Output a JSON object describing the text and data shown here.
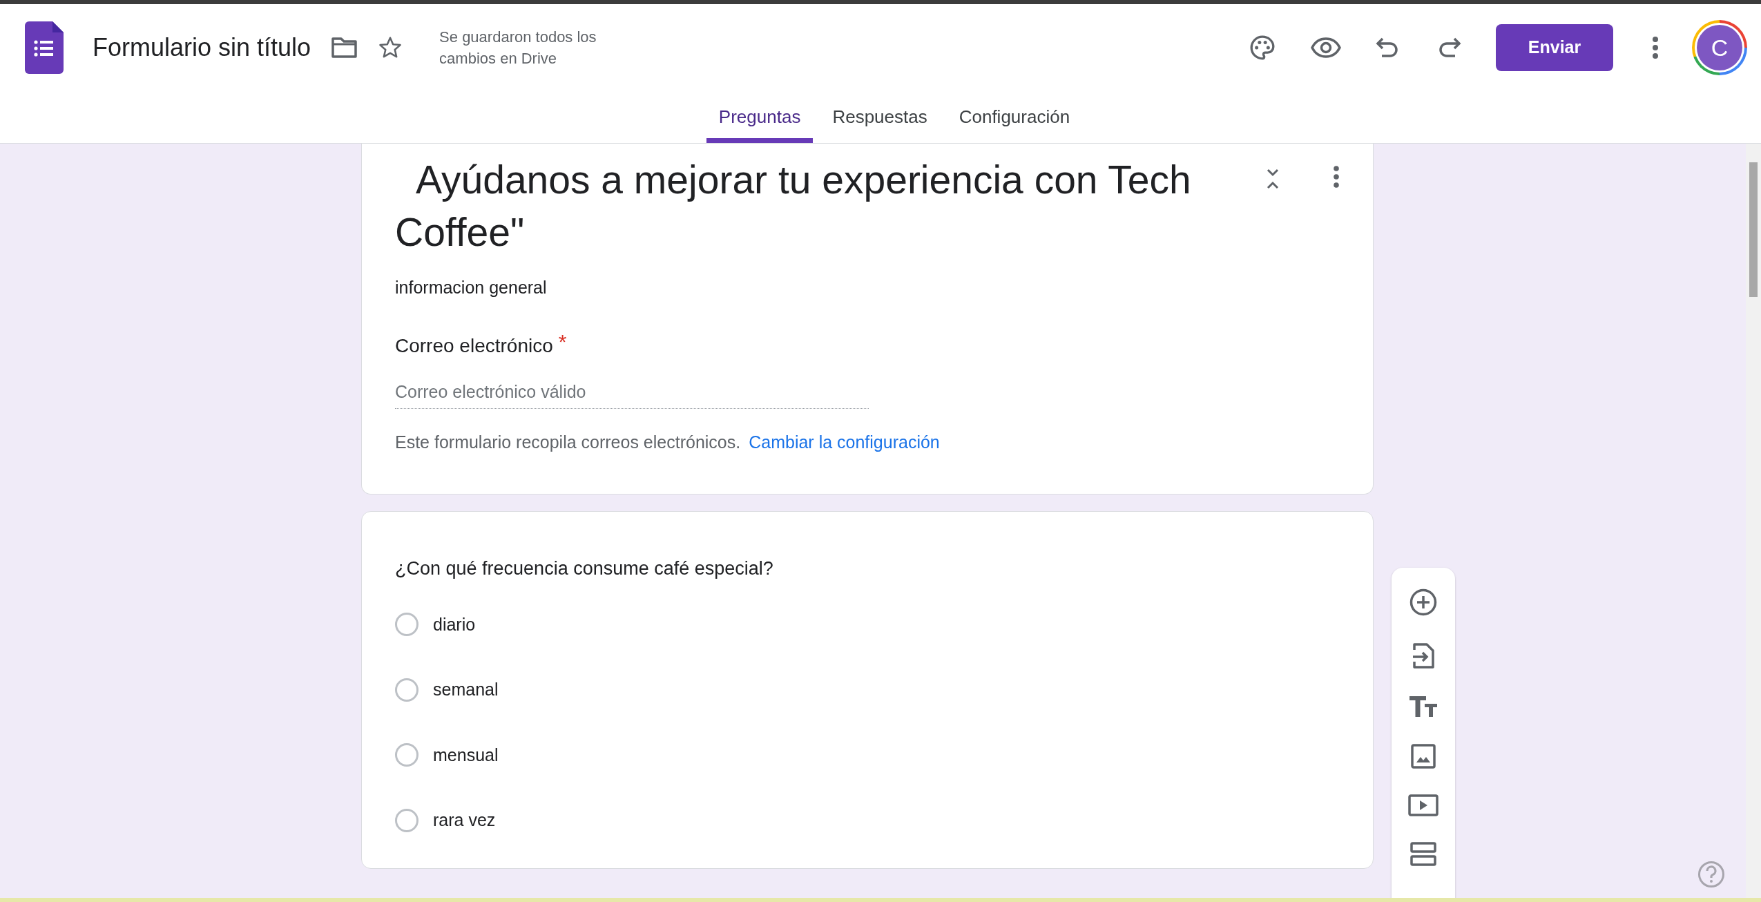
{
  "header": {
    "form_title": "Formulario sin título",
    "saved_status": "Se guardaron todos los cambios en Drive",
    "send_button": "Enviar",
    "avatar_letter": "C"
  },
  "tabs": [
    {
      "label": "Preguntas",
      "selected": true
    },
    {
      "label": "Respuestas",
      "selected": false
    },
    {
      "label": "Configuración",
      "selected": false
    }
  ],
  "form_header": {
    "title": "Ayúdanos a mejorar tu experiencia con Tech Coffee\"",
    "description": "informacion general",
    "email_question": {
      "label": "Correo electrónico",
      "required_mark": "*",
      "placeholder": "Correo electrónico válido"
    },
    "note": "Este formulario recopila correos electrónicos.",
    "link": "Cambiar la configuración"
  },
  "question": {
    "text": "¿Con qué frecuencia consume café especial?",
    "options": [
      {
        "label": "diario",
        "selected": false
      },
      {
        "label": "semanal",
        "selected": false
      },
      {
        "label": "mensual",
        "selected": false
      },
      {
        "label": "rara vez",
        "selected": false
      }
    ]
  }
}
